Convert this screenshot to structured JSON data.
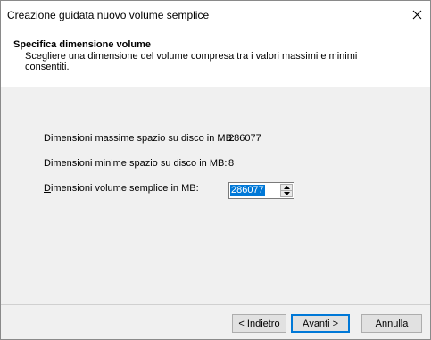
{
  "window": {
    "title": "Creazione guidata nuovo volume semplice"
  },
  "header": {
    "title": "Specifica dimensione volume",
    "description": "Scegliere una dimensione del volume compresa tra i valori massimi e minimi consentiti."
  },
  "form": {
    "max_label": "Dimensioni massime spazio su disco in MB:",
    "max_value": "286077",
    "min_label": "Dimensioni minime spazio su disco in MB:",
    "min_value": "8",
    "size_label_mnemonic": "D",
    "size_label_rest": "imensioni volume semplice in MB:",
    "size_value": "286077"
  },
  "buttons": {
    "back_prefix": "< ",
    "back_mnemonic": "I",
    "back_rest": "ndietro",
    "next_mnemonic": "A",
    "next_rest": "vanti >",
    "cancel": "Annulla"
  },
  "icons": {
    "close": "close-icon",
    "spin_up": "spin-up-icon",
    "spin_down": "spin-down-icon"
  }
}
